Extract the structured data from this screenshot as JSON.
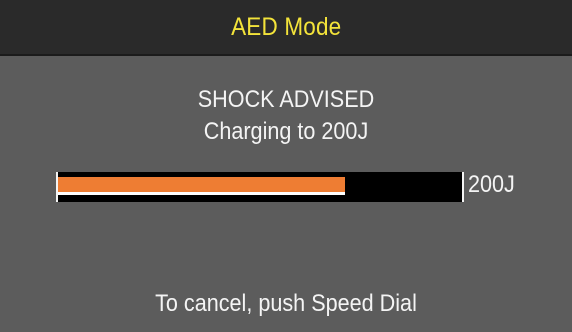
{
  "header": {
    "title": "AED Mode"
  },
  "status": {
    "line1": "SHOCK ADVISED",
    "line2": "Charging to 200J"
  },
  "charge": {
    "progress_fraction": 0.71,
    "target_label": "200J"
  },
  "footer": {
    "instruction": "To cancel, push Speed Dial"
  },
  "colors": {
    "background": "#5c5c5c",
    "header_bg": "#2a2a2a",
    "title": "#f3e33a",
    "text": "#f4f4f4",
    "bar_fill": "#ee7d33",
    "bar_track": "#000000"
  }
}
